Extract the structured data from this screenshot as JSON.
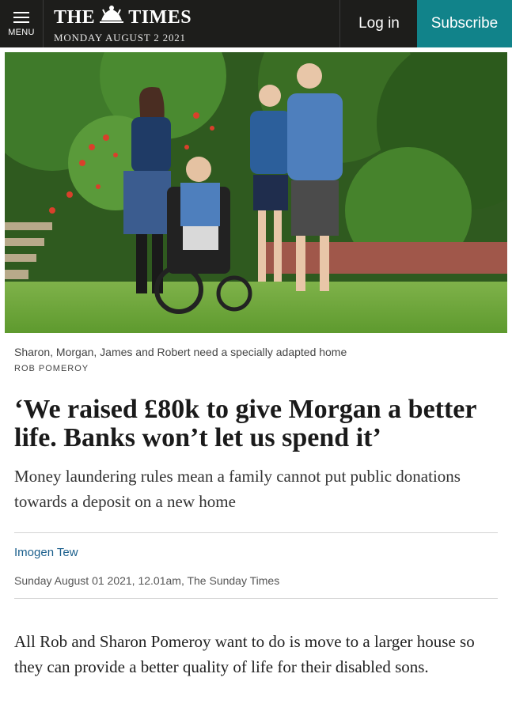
{
  "header": {
    "menu_label": "MENU",
    "logo_left": "THE",
    "logo_right": "TIMES",
    "date": "MONDAY AUGUST 2 2021",
    "login_label": "Log in",
    "subscribe_label": "Subscribe"
  },
  "colors": {
    "header_bg": "#1d1d1b",
    "subscribe_bg": "#11838a",
    "author_link": "#1b5f8c"
  },
  "article": {
    "caption": "Sharon, Morgan, James and Robert need a specially adapted home",
    "photo_credit": "ROB POMEROY",
    "headline": "‘We raised £80k to give Morgan a better life. Banks won’t let us spend it’",
    "standfirst": "Money laundering rules mean a family cannot put public donations towards a deposit on a new home",
    "author": "Imogen Tew",
    "dateline": "Sunday August 01 2021, 12.01am, The Sunday Times",
    "first_paragraph": "All Rob and Sharon Pomeroy want to do is move to a larger house so they can provide a better quality of life for their disabled sons."
  }
}
